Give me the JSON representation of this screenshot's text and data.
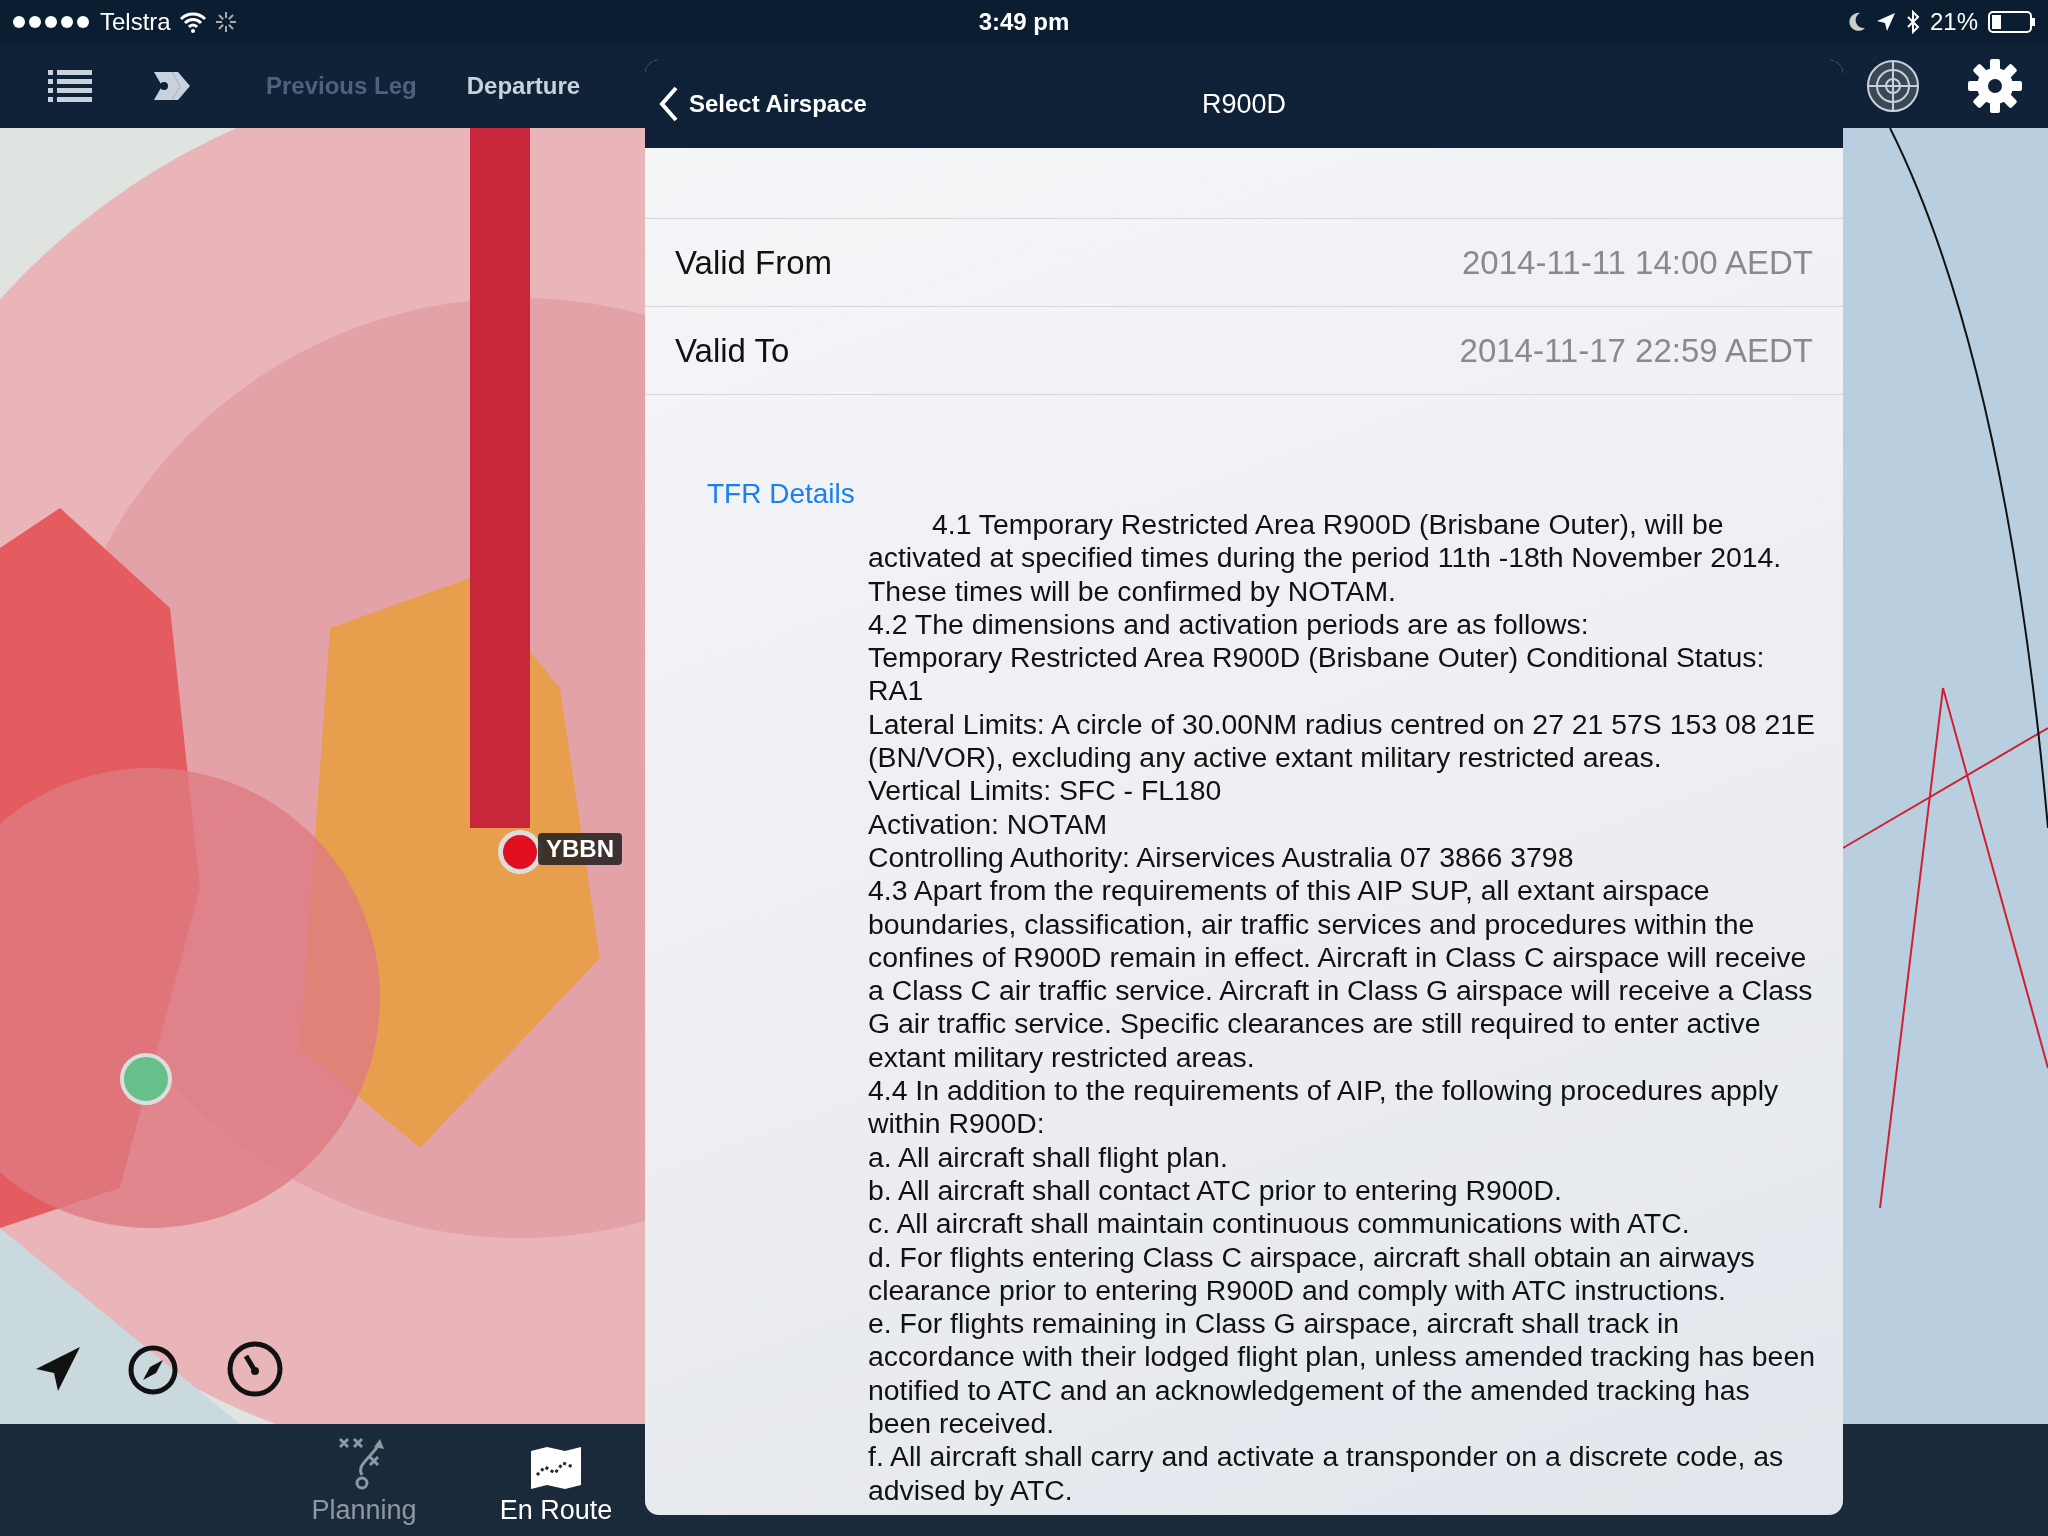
{
  "status_bar": {
    "carrier": "Telstra",
    "time": "3:49 pm",
    "battery": "21%"
  },
  "nav_buttons": [
    {
      "label": "Previous Leg",
      "disabled": true
    },
    {
      "label": "Departure",
      "disabled": false
    }
  ],
  "map": {
    "kind": "picture",
    "airport_label": "YBBN"
  },
  "panel": {
    "back_label": "Select Airspace",
    "title": "R900D",
    "fields": [
      {
        "label": "Valid From",
        "value": "2014-11-11 14:00 AEDT"
      },
      {
        "label": "Valid To",
        "value": "2014-11-17 22:59 AEDT"
      }
    ],
    "link": "TFR Details",
    "paragraphs": [
      {
        "text": "4.1 Temporary Restricted Area R900D (Brisbane Outer), will be activated at specified times during the period 11th -18th November 2014. These times will be confirmed by NOTAM.",
        "indented": true
      },
      {
        "text": "4.2 The dimensions and activation periods are as follows:",
        "indented": false
      },
      {
        "text": "Temporary Restricted Area R900D (Brisbane Outer) Conditional Status: RA1",
        "indented": false
      },
      {
        "text": "Lateral Limits: A circle of 30.00NM radius centred on 27 21 57S 153 08 21E (BN/VOR), excluding any active extant military restricted areas.",
        "indented": false
      },
      {
        "text": "Vertical Limits: SFC - FL180",
        "indented": false
      },
      {
        "text": "Activation: NOTAM",
        "indented": false
      },
      {
        "text": "Controlling Authority: Airservices Australia 07 3866 3798",
        "indented": false
      },
      {
        "text": "4.3 Apart from the requirements of this AIP SUP, all extant airspace boundaries, classification, air traffic services and procedures within the confines of R900D remain in effect. Aircraft in Class C airspace will receive a Class C air traffic service. Aircraft in Class G airspace will receive a Class G air traffic service. Specific clearances are still required to enter active extant military restricted areas.",
        "indented": false
      },
      {
        "text": "4.4 In addition to the requirements of AIP, the following procedures apply within R900D:",
        "indented": false
      },
      {
        "text": "a. All aircraft shall flight plan.",
        "indented": false
      },
      {
        "text": "b. All aircraft shall contact ATC prior to entering R900D.",
        "indented": false
      },
      {
        "text": "c. All aircraft shall maintain continuous communications with ATC.",
        "indented": false
      },
      {
        "text": "d. For flights entering Class C airspace, aircraft shall obtain an airways clearance prior to entering R900D and comply with ATC instructions.",
        "indented": false
      },
      {
        "text": "e. For flights remaining in Class G airspace, aircraft shall track in accordance with their lodged flight plan, unless amended tracking has been notified to ATC and an acknowledgement of the amended tracking has been received.",
        "indented": false
      },
      {
        "text": "f. All aircraft shall carry and activate a transponder on a discrete code, as advised by ATC.",
        "indented": false
      }
    ]
  },
  "tabs": [
    {
      "label": "Planning",
      "selected": false
    },
    {
      "label": "En Route",
      "selected": true
    }
  ]
}
